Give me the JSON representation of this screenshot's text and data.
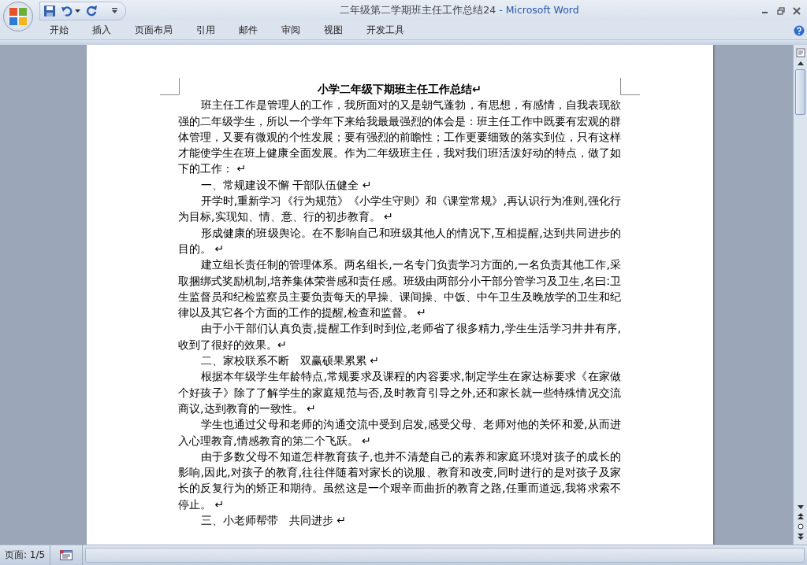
{
  "window": {
    "document_name": "二年级第二学期班主任工作总结24",
    "app_name": " - Microsoft Word"
  },
  "ribbon_tabs": [
    {
      "label": "开始",
      "selected": false
    },
    {
      "label": "插入",
      "selected": false
    },
    {
      "label": "页面布局",
      "selected": false
    },
    {
      "label": "引用",
      "selected": false
    },
    {
      "label": "邮件",
      "selected": false
    },
    {
      "label": "审阅",
      "selected": false
    },
    {
      "label": "视图",
      "selected": false
    },
    {
      "label": "开发工具",
      "selected": false
    }
  ],
  "document": {
    "title": "小学二年级下期班主任工作总结↵",
    "paragraphs": [
      "班主任工作是管理人的工作，我所面对的又是朝气蓬勃，有思想，有感情，自我表现欲强的二年级学生，所以一个学年下来给我最最强烈的体会是：班主任工作中既要有宏观的群体管理，又要有微观的个性发展；要有强烈的前瞻性；工作更要细致的落实到位，只有这样才能使学生在班上健康全面发展。作为二年级班主任，我对我们班活泼好动的特点，做了如下的工作： ↵",
      "一、常规建设不懈  干部队伍健全 ↵",
      "开学时,重新学习《行为规范》《小学生守则》和《课堂常规》,再认识行为准则,强化行为目标,实现知、情、意、行的初步教育。 ↵",
      "形成健康的班级舆论。在不影响自己和班级其他人的情况下,互相提醒,达到共同进步的目的。 ↵",
      "建立组长责任制的管理体系。两名组长,一名专门负责学习方面的,一名负责其他工作,采取捆绑式奖励机制,培养集体荣誉感和责任感。班级由两部分小干部分管学习及卫生,名曰:卫生监督员和纪检监察员主要负责每天的早操、课间操、中饭、中午卫生及晚放学的卫生和纪律以及其它各个方面的工作的提醒,检查和监督。 ↵",
      "由于小干部们认真负责,提醒工作到时到位,老师省了很多精力,学生生活学习井井有序,收到了很好的效果。↵",
      "二、家校联系不断　双赢硕果累累 ↵",
      "根据本年级学生年龄特点,常规要求及课程的内容要求,制定学生在家达标要求《在家做个好孩子》除了了解学生的家庭规范与否,及时教育引导之外,还和家长就一些特殊情况交流商议,达到教育的一致性。 ↵",
      "学生也通过父母和老师的沟通交流中受到启发,感受父母、老师对他的关怀和爱,从而进入心理教育,情感教育的第二个飞跃。 ↵",
      "由于多数父母不知道怎样教育孩子,也并不清楚自己的素养和家庭环境对孩子的成长的影响,因此,对孩子的教育,往往伴随着对家长的说服、教育和改变,同时进行的是对孩子及家长的反复行为的矫正和期待。虽然这是一个艰辛而曲折的教育之路,任重而道远,我将求索不停止。 ↵",
      "三、小老师帮带　共同进步 ↵"
    ]
  },
  "status_bar": {
    "page": "页面: 1/5"
  }
}
